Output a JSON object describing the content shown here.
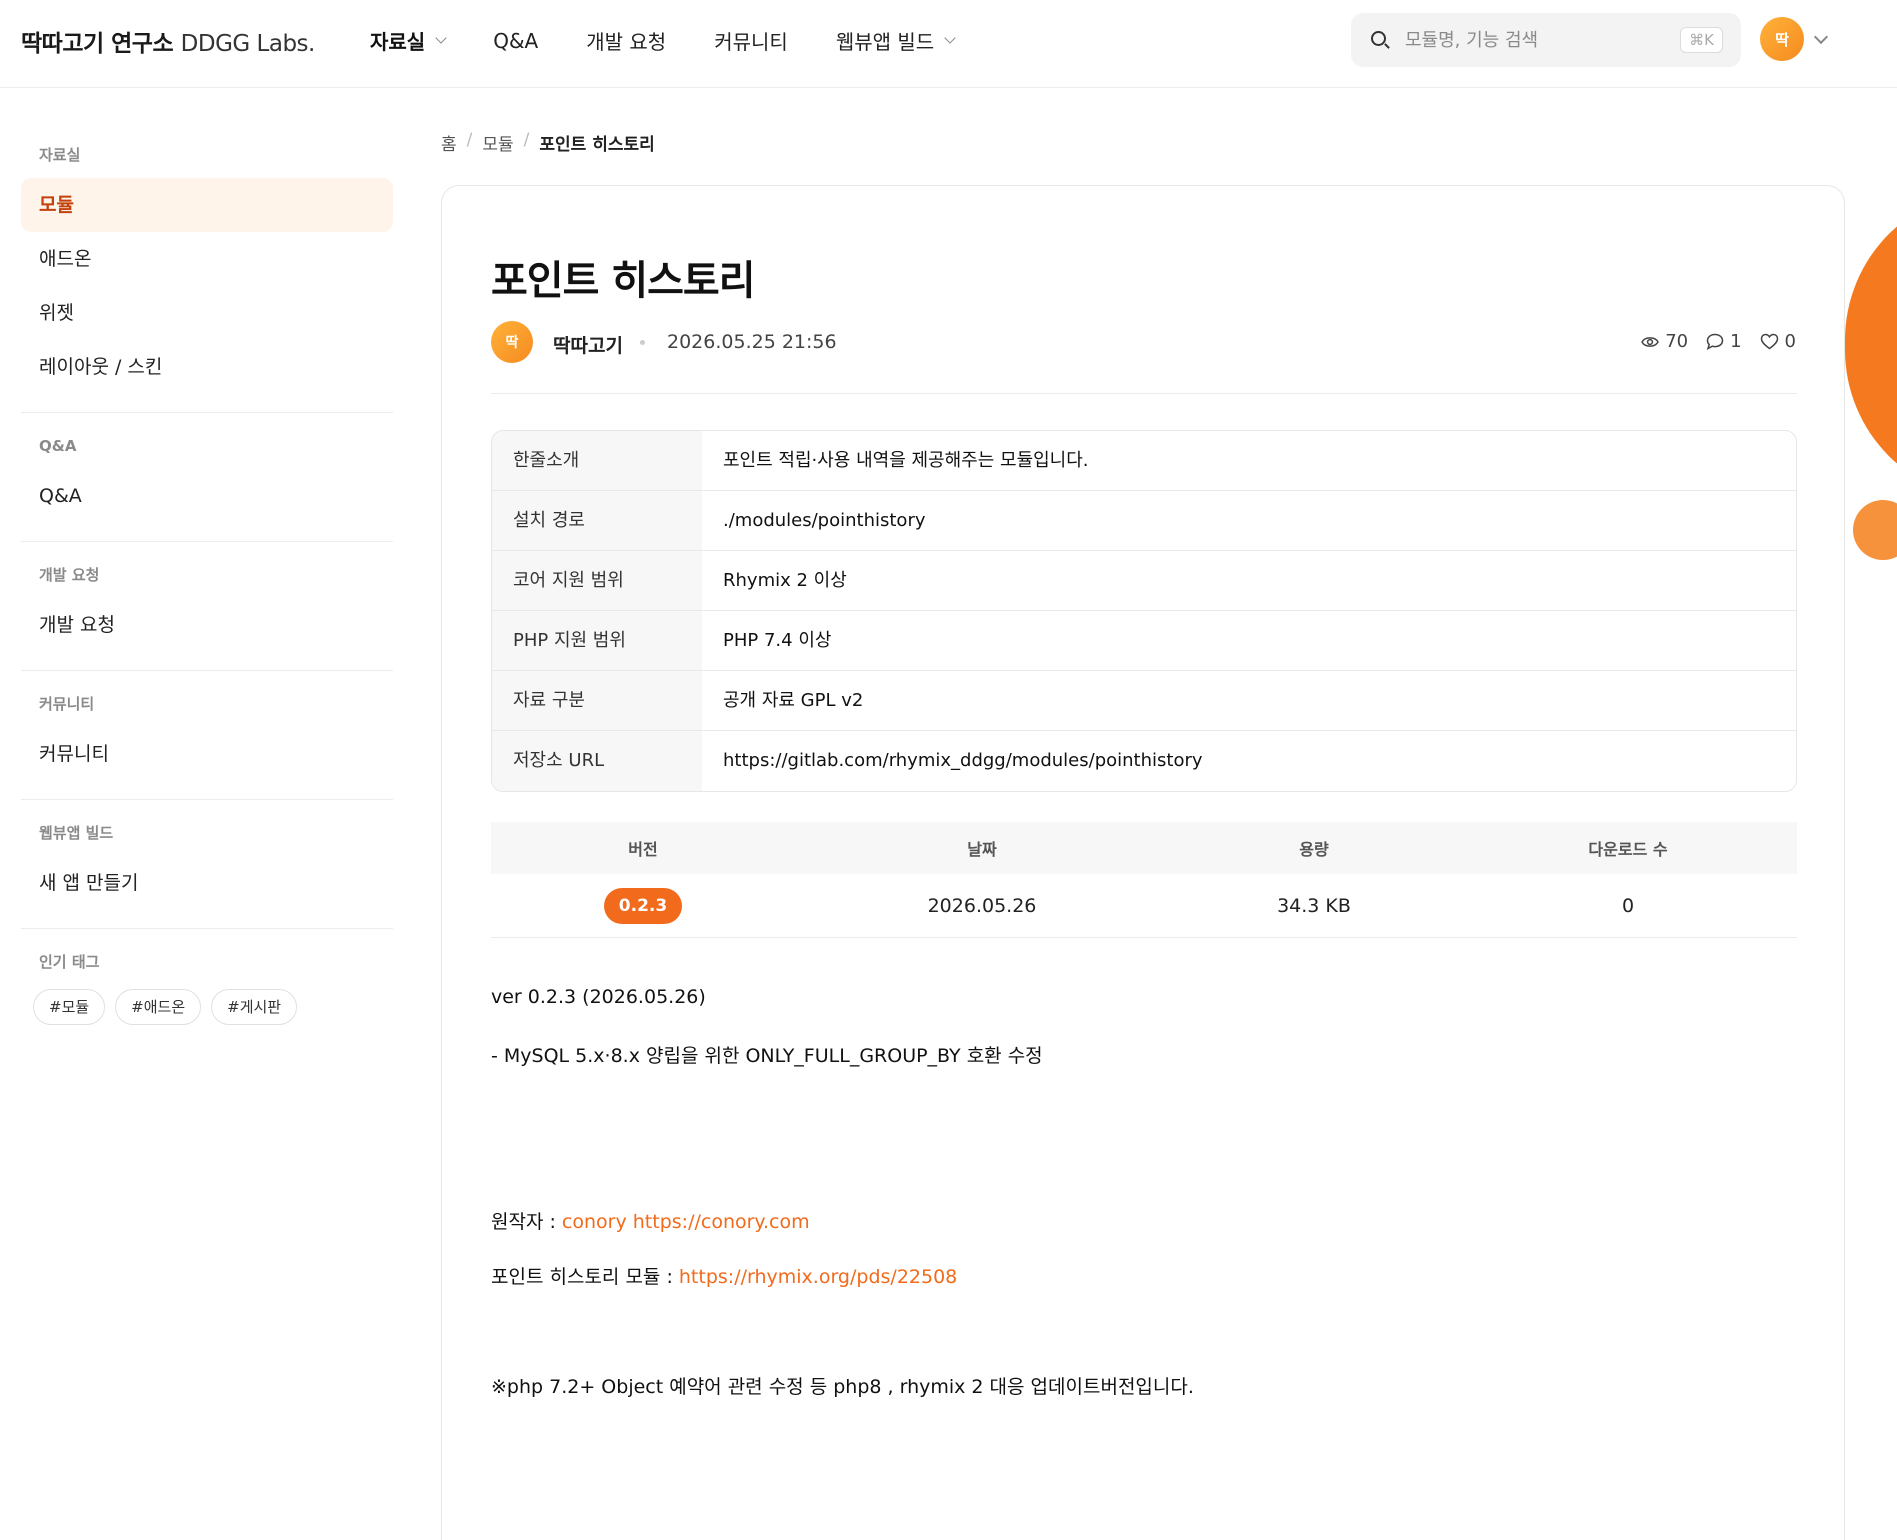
{
  "header": {
    "logo_kr": "딱따고기 연구소",
    "logo_en": "DDGG Labs.",
    "nav": [
      {
        "label": "자료실",
        "has_dropdown": true,
        "active": true
      },
      {
        "label": "Q&A"
      },
      {
        "label": "개발 요청"
      },
      {
        "label": "커뮤니티"
      },
      {
        "label": "웹뷰앱 빌드",
        "has_dropdown": true
      }
    ],
    "search_placeholder": "모듈명, 기능 검색",
    "search_shortcut": "⌘K",
    "avatar_text": "딱"
  },
  "sidebar": {
    "groups": [
      {
        "title": "자료실",
        "items": [
          {
            "label": "모듈",
            "active": true
          },
          {
            "label": "애드온"
          },
          {
            "label": "위젯"
          },
          {
            "label": "레이아웃 / 스킨"
          }
        ]
      },
      {
        "title": "Q&A",
        "items": [
          {
            "label": "Q&A"
          }
        ]
      },
      {
        "title": "개발 요청",
        "items": [
          {
            "label": "개발 요청"
          }
        ]
      },
      {
        "title": "커뮤니티",
        "items": [
          {
            "label": "커뮤니티"
          }
        ]
      },
      {
        "title": "웹뷰앱 빌드",
        "items": [
          {
            "label": "새 앱 만들기"
          }
        ]
      }
    ],
    "tags_title": "인기 태그",
    "tags": [
      "#모듈",
      "#애드온",
      "#게시판"
    ]
  },
  "breadcrumb": [
    "홈",
    "모듈",
    "포인트 히스토리"
  ],
  "post": {
    "title": "포인트 히스토리",
    "author_avatar": "딱",
    "author": "딱따고기",
    "date": "2026.05.25 21:56",
    "views": "70",
    "comments": "1",
    "likes": "0"
  },
  "info": [
    {
      "key": "한줄소개",
      "value": "포인트 적립·사용 내역을 제공해주는 모듈입니다."
    },
    {
      "key": "설치 경로",
      "value": "./modules/pointhistory"
    },
    {
      "key": "코어 지원 범위",
      "value": "Rhymix 2 이상"
    },
    {
      "key": "PHP 지원 범위",
      "value": "PHP 7.4 이상"
    },
    {
      "key": "자료 구분",
      "value": "공개 자료 GPL v2"
    },
    {
      "key": "저장소 URL",
      "value": "https://gitlab.com/rhymix_ddgg/modules/pointhistory"
    }
  ],
  "versions": {
    "headers": [
      "버전",
      "날짜",
      "용량",
      "다운로드 수"
    ],
    "rows": [
      {
        "version": "0.2.3",
        "date": "2026.05.26",
        "size": "34.3 KB",
        "downloads": "0"
      }
    ]
  },
  "content": {
    "line1": "ver 0.2.3 (2026.05.26)",
    "line2": "- MySQL 5.x·8.x 양립을 위한 ONLY_FULL_GROUP_BY 호환 수정",
    "author_label": "원작자 : ",
    "author_link_name": "conory",
    "author_link_url": "https://conory.com",
    "orig_label": "포인트 히스토리 모듈 : ",
    "orig_link": "https://rhymix.org/pds/22508",
    "note": "※php 7.2+ Object 예약어 관련 수정 등 php8 , rhymix 2 대응 업데이트버전입니다."
  },
  "colors": {
    "accent": "#f26a1b",
    "active_bg": "#fff4ea"
  }
}
